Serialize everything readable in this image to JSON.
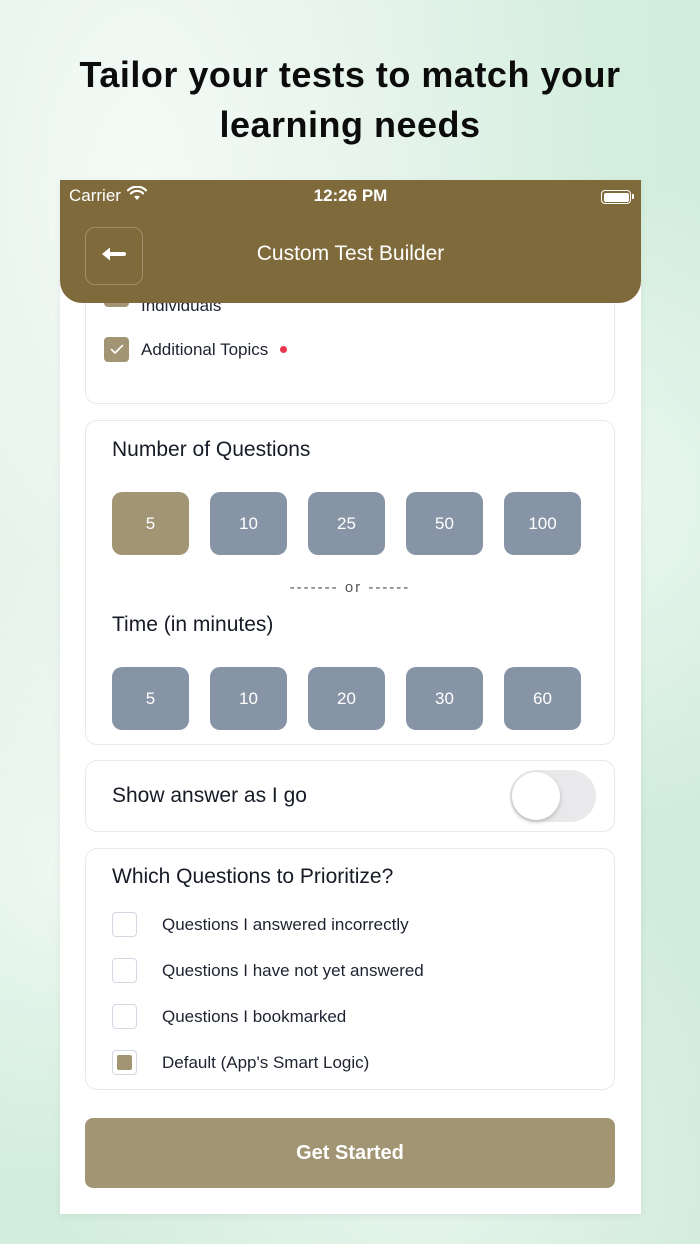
{
  "headline": {
    "line1": "Tailor your tests to match your",
    "line2": "learning needs"
  },
  "status_bar": {
    "carrier": "Carrier",
    "time": "12:26 PM"
  },
  "app_bar": {
    "title": "Custom Test Builder",
    "back_icon": "arrow-left-icon"
  },
  "topics": {
    "items": [
      {
        "label": "Individuals",
        "checked": true,
        "flagged": true
      },
      {
        "label": "Additional Topics",
        "checked": true,
        "flagged": true
      }
    ]
  },
  "question_count": {
    "title": "Number of Questions",
    "options": [
      "5",
      "10",
      "25",
      "50",
      "100"
    ],
    "selected": "5",
    "divider": "------- or ------"
  },
  "time_limit": {
    "title": "Time (in minutes)",
    "options": [
      "5",
      "10",
      "20",
      "30",
      "60"
    ]
  },
  "show_answer": {
    "label": "Show answer as I go",
    "enabled": false
  },
  "prioritize": {
    "title": "Which Questions to Prioritize?",
    "options": [
      {
        "label": "Questions I answered incorrectly",
        "checked": false
      },
      {
        "label": "Questions I have not yet answered",
        "checked": false
      },
      {
        "label": "Questions I bookmarked",
        "checked": false
      },
      {
        "label": "Default (App's Smart Logic)",
        "checked": true
      }
    ]
  },
  "cta": {
    "label": "Get Started"
  },
  "colors": {
    "app_bar": "#7f6a3b",
    "accent": "#a29574",
    "pill": "#8794a6",
    "flag": "#e8364f"
  }
}
